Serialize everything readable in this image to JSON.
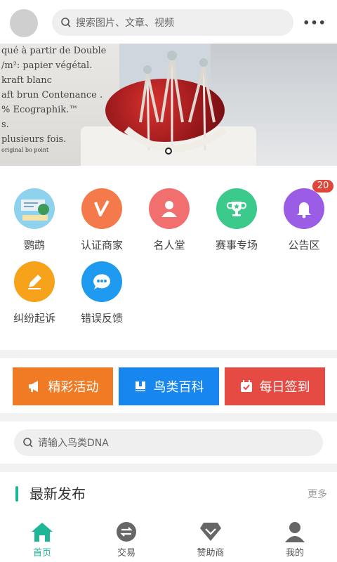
{
  "header": {
    "search_placeholder": "搜索图片、文章、视频",
    "more_label": "•••"
  },
  "banner": {
    "text_lines": [
      "qué à partir de Double",
      "/m²: papier végétal.",
      "kraft blanc",
      "aft brun Contenance .",
      "%   Ecographik.™",
      "s.",
      "plusieurs fois.",
      "original bo point"
    ]
  },
  "grid": {
    "items": [
      {
        "label": "鹦鹉",
        "color": "#7cc8e8",
        "icon": "parrot-photo-icon"
      },
      {
        "label": "认证商家",
        "color": "#f57a4b",
        "icon": "verified-v-icon"
      },
      {
        "label": "名人堂",
        "color": "#f26f6f",
        "icon": "person-icon"
      },
      {
        "label": "赛事专场",
        "color": "#3cc98c",
        "icon": "trophy-icon"
      },
      {
        "label": "公告区",
        "color": "#9b5de5",
        "icon": "bell-icon"
      },
      {
        "label": "纠纷起诉",
        "color": "#f7a21b",
        "icon": "pencil-icon"
      },
      {
        "label": "错误反馈",
        "color": "#1e9bf0",
        "icon": "chat-bubble-icon"
      }
    ],
    "notice_badge": "20"
  },
  "actions": [
    {
      "label": "精彩活动",
      "color": "#f07b24",
      "icon": "megaphone-icon"
    },
    {
      "label": "鸟类百科",
      "color": "#1787ef",
      "icon": "book-icon"
    },
    {
      "label": "每日签到",
      "color": "#e54b43",
      "icon": "calendar-check-icon"
    }
  ],
  "dna_search": {
    "placeholder": "请输入鸟类DNA"
  },
  "latest": {
    "title": "最新发布",
    "more": "更多"
  },
  "nav": {
    "active_color": "#1fb597",
    "items": [
      {
        "label": "首页",
        "icon": "home-icon"
      },
      {
        "label": "交易",
        "icon": "exchange-icon"
      },
      {
        "label": "赞助商",
        "icon": "diamond-icon"
      },
      {
        "label": "我的",
        "icon": "user-icon"
      }
    ]
  }
}
